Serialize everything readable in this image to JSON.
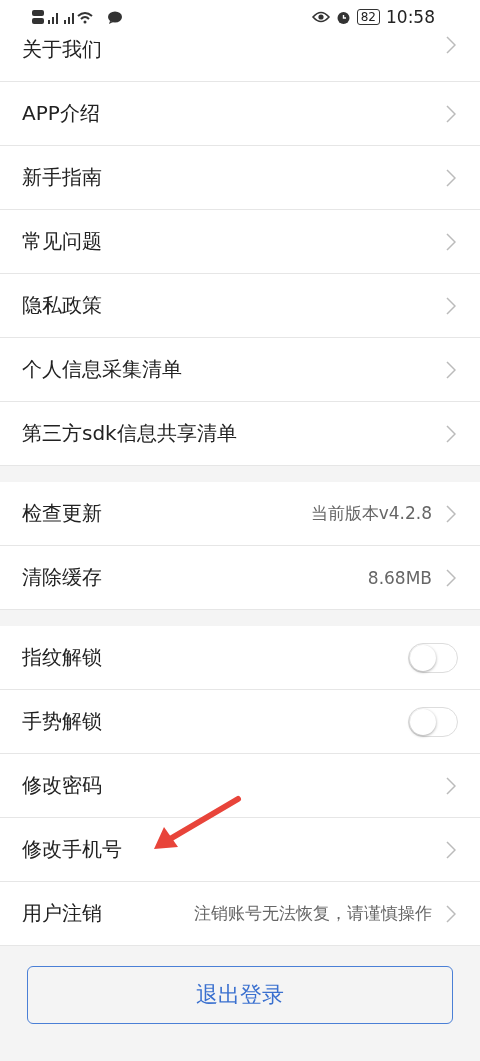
{
  "status_bar": {
    "battery": "82",
    "time": "10:58"
  },
  "sections": [
    {
      "items": [
        {
          "kind": "link",
          "label": "关于我们"
        },
        {
          "kind": "link",
          "label": "APP介绍"
        },
        {
          "kind": "link",
          "label": "新手指南"
        },
        {
          "kind": "link",
          "label": "常见问题"
        },
        {
          "kind": "link",
          "label": "隐私政策"
        },
        {
          "kind": "link",
          "label": "个人信息采集清单"
        },
        {
          "kind": "link",
          "label": "第三方sdk信息共享清单"
        }
      ]
    },
    {
      "items": [
        {
          "kind": "link",
          "label": "检查更新",
          "value": "当前版本v4.2.8"
        },
        {
          "kind": "link",
          "label": "清除缓存",
          "value": "8.68MB"
        }
      ]
    },
    {
      "items": [
        {
          "kind": "toggle",
          "label": "指纹解锁",
          "on": false
        },
        {
          "kind": "toggle",
          "label": "手势解锁",
          "on": false
        },
        {
          "kind": "link",
          "label": "修改密码"
        },
        {
          "kind": "link",
          "label": "修改手机号"
        },
        {
          "kind": "link",
          "label": "用户注销",
          "value": "注销账号无法恢复，请谨慎操作"
        }
      ]
    }
  ],
  "logout_button": "退出登录"
}
